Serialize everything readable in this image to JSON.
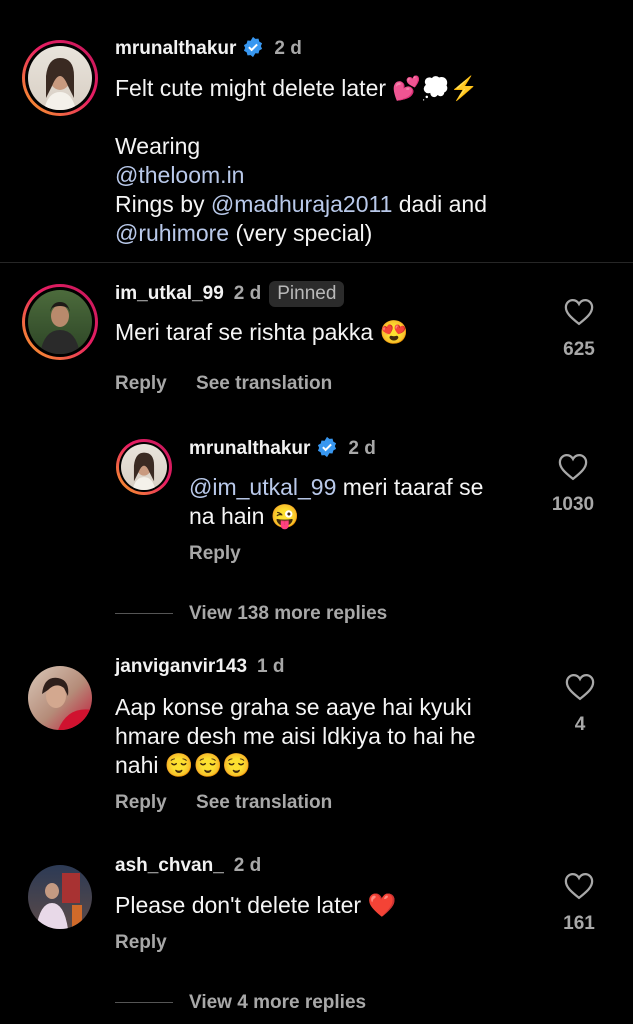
{
  "caption": {
    "username": "mrunalthakur",
    "time": "2 d",
    "line1": "Felt cute might delete later",
    "line1_emoji": "💕💭⚡",
    "wearing": "Wearing",
    "mention_loom": "@theloom.in",
    "rings_prefix": "Rings by ",
    "mention_madhu": "@madhuraja2011",
    "rings_suffix": " dadi and",
    "mention_ruhi": "@ruhimore",
    "ruhi_suffix": " (very special)"
  },
  "comments": [
    {
      "username": "im_utkal_99",
      "time": "2 d",
      "badge": "Pinned",
      "text": "Meri taraf se rishta pakka",
      "emoji": "😍",
      "likes": "625",
      "reply": "Reply",
      "translate": "See translation"
    },
    {
      "username": "janviganvir143",
      "time": "1 d",
      "text_l1": "Aap konse graha se aaye hai kyuki",
      "text_l2": "hmare desh me aisi ldkiya to hai he",
      "text_l3": "nahi",
      "emoji": "😌😌😌",
      "likes": "4",
      "reply": "Reply",
      "translate": "See translation"
    },
    {
      "username": "ash_chvan_",
      "time": "2 d",
      "text": "Please don't delete later",
      "emoji": "❤️",
      "likes": "161",
      "reply": "Reply"
    }
  ],
  "reply": {
    "username": "mrunalthakur",
    "time": "2 d",
    "mention": "@im_utkal_99",
    "text_l1": " meri taaraf se",
    "text_l2": "na hain",
    "emoji": "😜",
    "likes": "1030",
    "reply": "Reply"
  },
  "view_more_1": "View 138 more replies",
  "view_more_2": "View 4 more replies",
  "colors": {
    "background": "#000000",
    "mention": "#b9c9ea",
    "verified": "#3897f0",
    "secondary": "#a8a8a8"
  }
}
